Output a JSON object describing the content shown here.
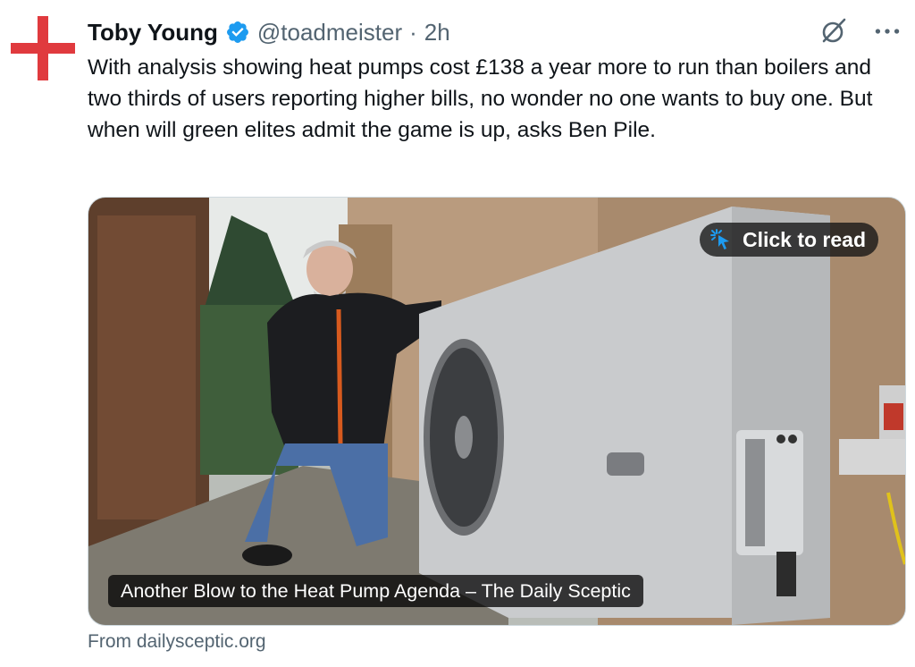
{
  "tweet": {
    "author_name": "Toby Young",
    "handle": "@toadmeister",
    "separator": "·",
    "time": "2h",
    "text": "With analysis showing heat pumps cost £138 a year more to run than boilers and two thirds of users reporting higher bills, no wonder no one wants to buy one. But when will green elites admit the game is up, asks Ben Pile."
  },
  "card": {
    "click_to_read": "Click to read",
    "title": "Another Blow to the Heat Pump Agenda – The Daily Sceptic",
    "source": "From dailysceptic.org"
  },
  "icons": {
    "avatar": "red-cross-icon",
    "verified": "verified-badge-icon",
    "grok": "grok-icon",
    "more": "more-icon",
    "pointer": "cursor-click-icon"
  },
  "colors": {
    "verified_blue": "#1d9bf0",
    "avatar_red": "#e03a3e",
    "secondary_text": "#536471"
  }
}
